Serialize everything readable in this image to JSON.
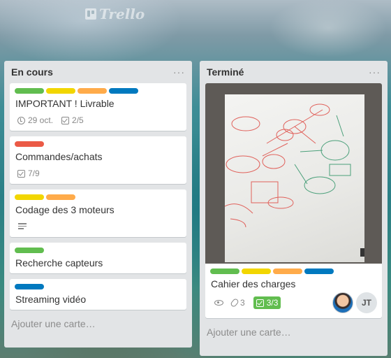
{
  "app": {
    "logo_text": "Trello"
  },
  "lists": [
    {
      "title": "En cours",
      "menu": "···",
      "add_card": "Ajouter une carte…",
      "cards": [
        {
          "title": "IMPORTANT ! Livrable",
          "labels": [
            "green",
            "yellow",
            "orange",
            "blue"
          ],
          "due": "29 oct.",
          "checklist": "2/5"
        },
        {
          "title": "Commandes/achats",
          "labels": [
            "red"
          ],
          "checklist": "7/9"
        },
        {
          "title": "Codage des 3 moteurs",
          "labels": [
            "yellow",
            "orange"
          ],
          "has_description": true
        },
        {
          "title": "Recherche capteurs",
          "labels": [
            "green"
          ]
        },
        {
          "title": "Streaming vidéo",
          "labels": [
            "blue"
          ]
        }
      ]
    },
    {
      "title": "Terminé",
      "menu": "···",
      "add_card": "Ajouter une carte…",
      "cards": [
        {
          "title": "Cahier des charges",
          "labels": [
            "green",
            "yellow",
            "orange",
            "blue"
          ],
          "has_cover": true,
          "attachments": "3",
          "checklist": "3/3",
          "members": [
            "avatar",
            "JT"
          ]
        }
      ]
    }
  ],
  "colors": {
    "green": "#61bd4f",
    "yellow": "#f2d600",
    "orange": "#ffab4a",
    "blue": "#0079bf",
    "red": "#eb5a46",
    "list_bg": "#e2e4e6"
  }
}
